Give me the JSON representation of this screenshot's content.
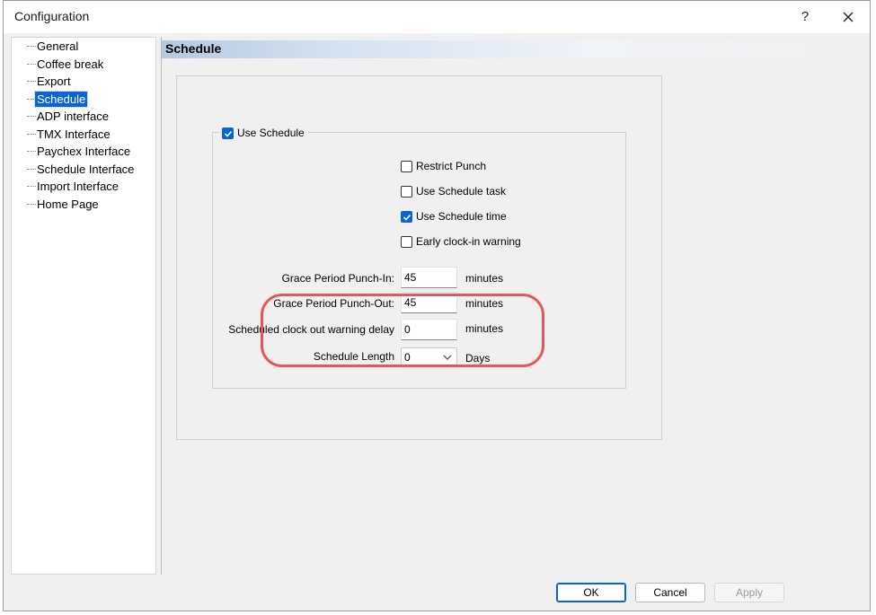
{
  "window": {
    "title": "Configuration",
    "help_label": "?",
    "close_icon": "close-icon"
  },
  "tree": {
    "items": [
      {
        "label": "General"
      },
      {
        "label": "Coffee break"
      },
      {
        "label": "Export"
      },
      {
        "label": "Schedule",
        "selected": true
      },
      {
        "label": "ADP interface"
      },
      {
        "label": "TMX Interface"
      },
      {
        "label": "Paychex Interface"
      },
      {
        "label": "Schedule Interface"
      },
      {
        "label": "Import Interface"
      },
      {
        "label": "Home Page"
      }
    ]
  },
  "content": {
    "heading": "Schedule",
    "use_schedule": {
      "label": "Use Schedule",
      "checked": true
    },
    "options": {
      "restrict_punch": {
        "label": "Restrict Punch",
        "checked": false
      },
      "use_schedule_task": {
        "label": "Use Schedule task",
        "checked": false
      },
      "use_schedule_time": {
        "label": "Use Schedule time",
        "checked": true
      },
      "early_clock_in": {
        "label": "Early clock-in warning",
        "checked": false
      }
    },
    "fields": {
      "grace_in": {
        "label": "Grace Period Punch-In:",
        "value": "45",
        "unit": "minutes"
      },
      "grace_out": {
        "label": "Grace Period Punch-Out:",
        "value": "45",
        "unit": "minutes"
      },
      "clock_out_delay": {
        "label": "Scheduled clock out warning delay",
        "value": "0",
        "unit": "minutes"
      },
      "schedule_length": {
        "label": "Schedule Length",
        "value": "0",
        "unit": "Days"
      }
    }
  },
  "buttons": {
    "ok": "OK",
    "cancel": "Cancel",
    "apply": "Apply"
  },
  "colors": {
    "accent": "#0a64d6",
    "highlight": "#e8555e",
    "heading_gradient": "#b6c9e0"
  }
}
